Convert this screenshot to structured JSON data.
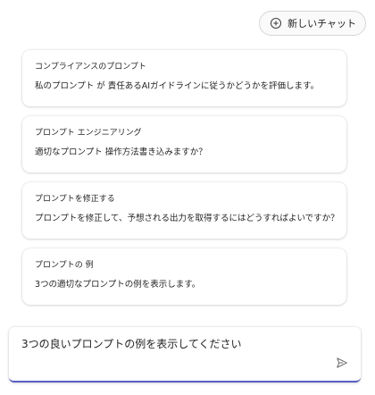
{
  "header": {
    "new_chat_label": "新しいチャット",
    "new_chat_icon": "chat-add-icon"
  },
  "prompt_cards": [
    {
      "title": "コンプライアンスのプロンプト",
      "description": "私のプロンプト が 責任あるAIガイドラインに従うかどうかを評価します。"
    },
    {
      "title": "プロンプト エンジニアリング",
      "description": "適切なプロンプト 操作方法書き込みますか？"
    },
    {
      "title": "プロンプトを修正する",
      "description": "プロンプトを修正して、予想される出力を取得するにはどうすればよいですか？"
    },
    {
      "title": "プロンプトの 例",
      "description": "3つの適切なプロンプトの例を表示します。"
    }
  ],
  "composer": {
    "input_value": "3つの良いプロンプトの例を表示してください",
    "send_icon": "send-icon",
    "accent_color": "#5b5fc7"
  }
}
